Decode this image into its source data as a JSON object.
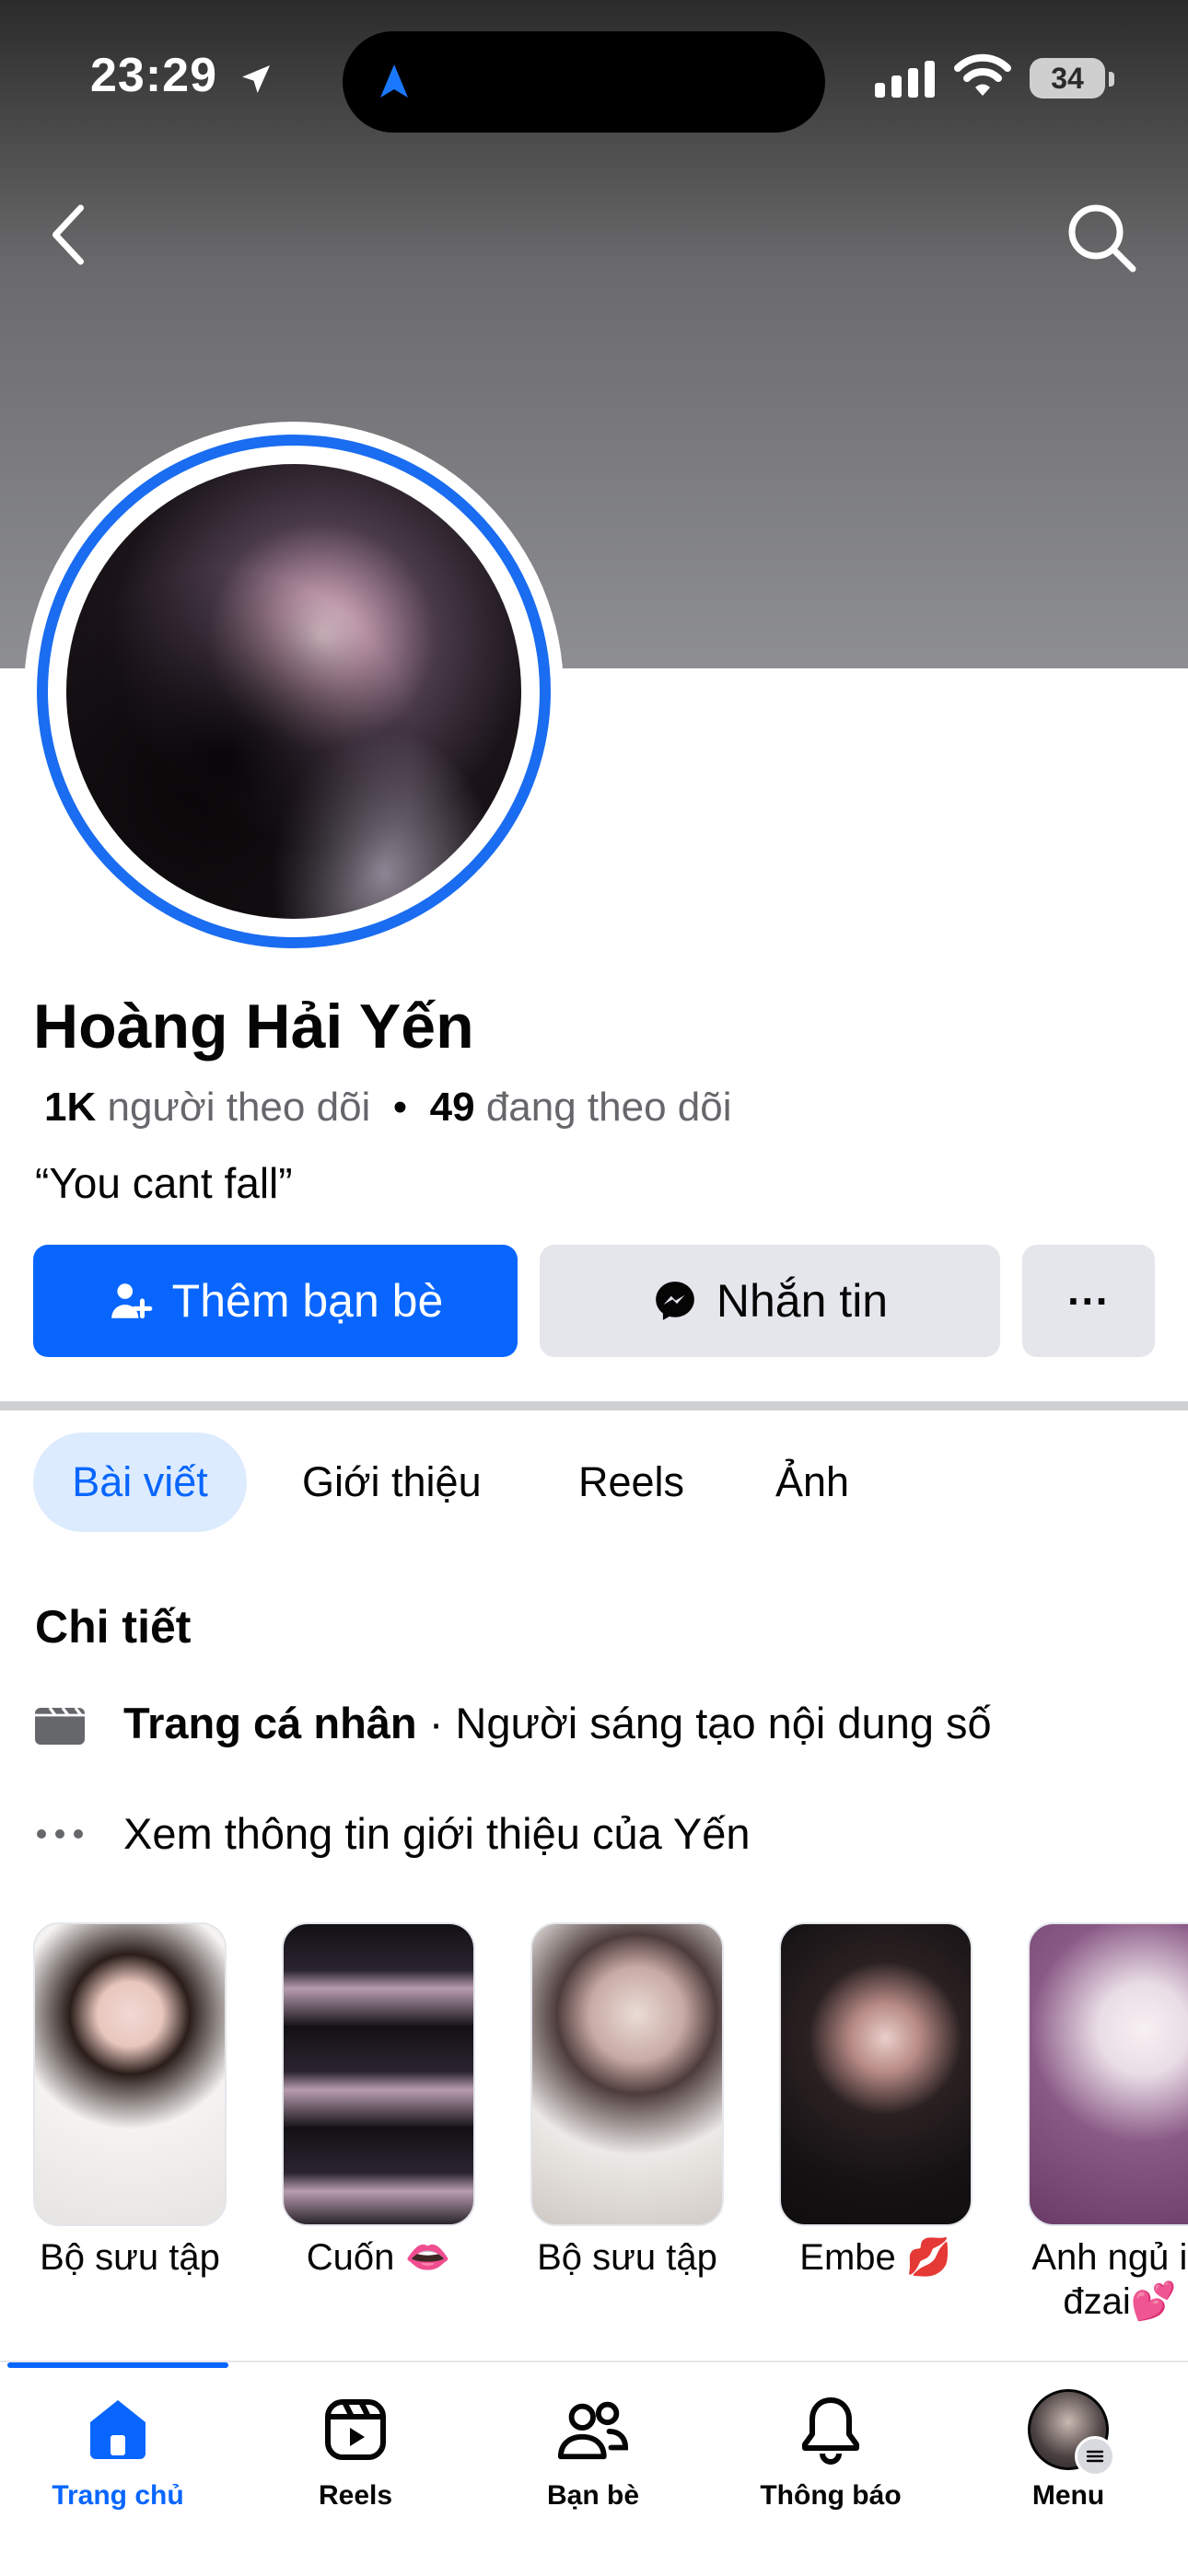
{
  "status_bar": {
    "time": "23:29",
    "battery": "34"
  },
  "profile": {
    "name": "Hoàng Hải Yến",
    "followers_count": "1K",
    "followers_label": "người theo dõi",
    "separator": "•",
    "following_count": "49",
    "following_label": "đang theo dõi",
    "bio": "“You cant fall”"
  },
  "actions": {
    "add_friend": "Thêm bạn bè",
    "message": "Nhắn tin",
    "more": "···"
  },
  "tabs": [
    "Bài viết",
    "Giới thiệu",
    "Reels",
    "Ảnh"
  ],
  "details": {
    "title": "Chi tiết",
    "page_type_bold": "Trang cá nhân",
    "page_type_rest": " · Người sáng tạo nội dung số",
    "see_about": "Xem thông tin giới thiệu của Yến"
  },
  "highlights": [
    "Bộ sưu tập",
    "Cuốn 👄",
    "Bộ sưu tập",
    "Embe 💋",
    "Anh ngủ iu đzai💕"
  ],
  "bottom_nav": [
    "Trang chủ",
    "Reels",
    "Bạn bè",
    "Thông báo",
    "Menu"
  ],
  "colors": {
    "accent": "#0866ff",
    "avatar_ring": "#1a6cf0",
    "secondary_bg": "#e4e6eb"
  }
}
